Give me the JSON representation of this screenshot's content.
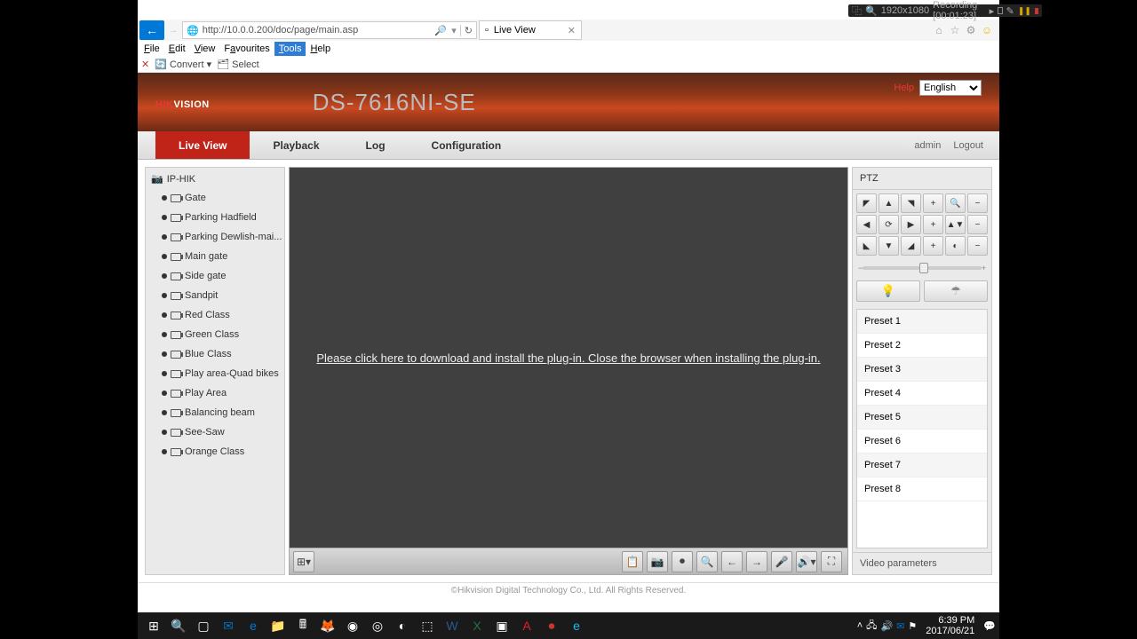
{
  "recorder": {
    "res": "1920x1080",
    "status": "Recording [00:01:23]"
  },
  "window": {
    "min": "—",
    "max": "☐",
    "close": "✕"
  },
  "ie": {
    "url": "http://10.0.0.200/doc/page/main.asp",
    "tab_title": "Live View",
    "menu": [
      "File",
      "Edit",
      "View",
      "Favourites",
      "Tools",
      "Help"
    ],
    "menu_selected": 4,
    "sub": {
      "close": "✕",
      "convert": "Convert",
      "select": "Select"
    }
  },
  "hik": {
    "logo_pre": "HIK",
    "logo_post": "VISION",
    "model": "DS-7616NI-SE",
    "help": "Help",
    "lang": "English",
    "nav": [
      "Live View",
      "Playback",
      "Log",
      "Configuration"
    ],
    "nav_active": 0,
    "user": "admin",
    "logout": "Logout"
  },
  "cameras": {
    "root": "IP-HIK",
    "items": [
      "Gate",
      "Parking Hadfield",
      "Parking Dewlish-mai...",
      "Main gate",
      "Side gate",
      "Sandpit",
      "Red Class",
      "Green Class",
      "Blue Class",
      "Play area-Quad bikes",
      "Play Area",
      "Balancing beam",
      "See-Saw",
      "Orange Class"
    ]
  },
  "video": {
    "plugin_msg": "Please click here to download and install the plug-in. Close the browser when installing the plug-in."
  },
  "ptz": {
    "title": "PTZ",
    "presets": [
      "Preset 1",
      "Preset 2",
      "Preset 3",
      "Preset 4",
      "Preset 5",
      "Preset 6",
      "Preset 7",
      "Preset 8"
    ],
    "video_params": "Video parameters"
  },
  "footer": "©Hikvision Digital Technology Co., Ltd. All Rights Reserved.",
  "taskbar": {
    "time": "6:39 PM",
    "date": "2017/06/21"
  }
}
